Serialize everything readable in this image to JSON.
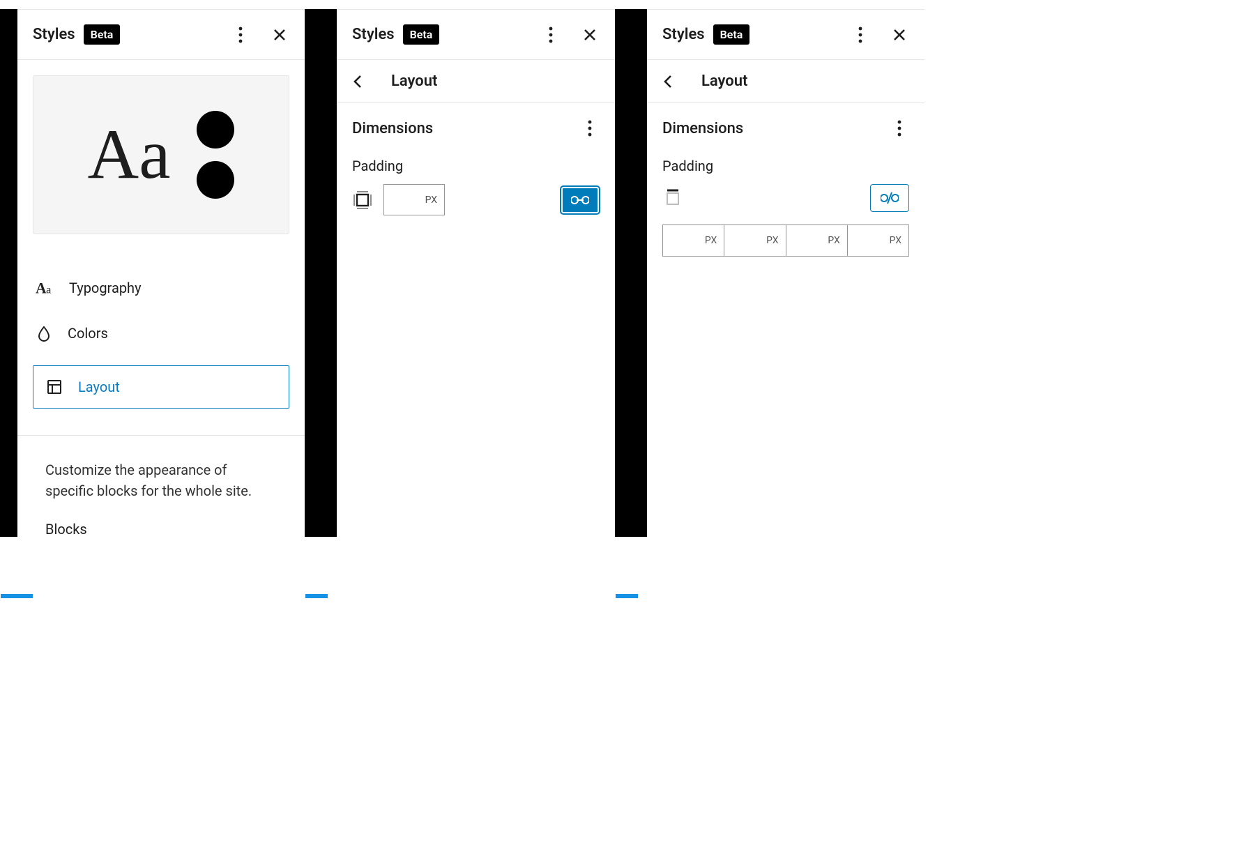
{
  "accent": "#007cba",
  "header": {
    "title": "Styles",
    "badge": "Beta"
  },
  "panel1": {
    "preview_sample": "Aa",
    "menu": {
      "typography": "Typography",
      "colors": "Colors",
      "layout": "Layout"
    },
    "blocks_desc": "Customize the appearance of specific blocks for the whole site.",
    "blocks_title": "Blocks"
  },
  "panel2": {
    "back_title": "Layout",
    "section": "Dimensions",
    "padding_label": "Padding",
    "unit": "PX"
  },
  "panel3": {
    "back_title": "Layout",
    "section": "Dimensions",
    "padding_label": "Padding",
    "unit": "PX"
  }
}
